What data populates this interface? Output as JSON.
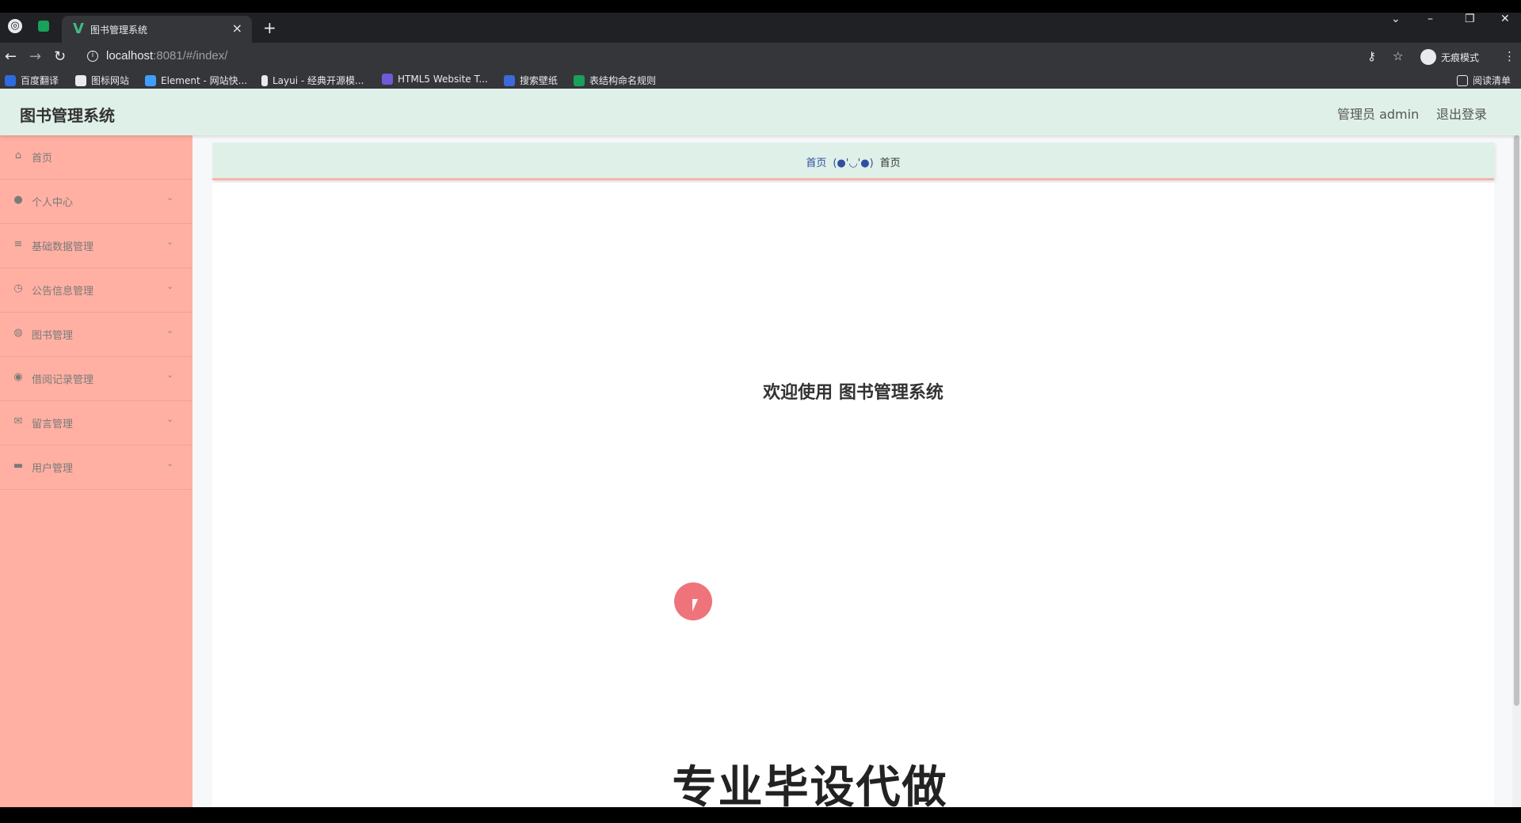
{
  "browser": {
    "tab_title": "图书管理系统",
    "url_host": "localhost",
    "url_rest": ":8081/#/index/",
    "incognito_label": "无痕模式",
    "reading_list": "阅读清单",
    "bookmarks": [
      {
        "label": "百度翻译",
        "color": "#2d6bdf"
      },
      {
        "label": "图标网站",
        "color": "#e8eaed"
      },
      {
        "label": "Element - 网站快...",
        "color": "#409eff"
      },
      {
        "label": "Layui - 经典开源模...",
        "color": "#e8eaed"
      },
      {
        "label": "HTML5 Website T...",
        "color": "#6f5bd8"
      },
      {
        "label": "搜索壁纸",
        "color": "#3b6bd8"
      },
      {
        "label": "表结构命名规则",
        "color": "#19a05a"
      }
    ]
  },
  "app": {
    "title": "图书管理系统",
    "user_label": "管理员 admin",
    "logout_label": "退出登录"
  },
  "sidebar": {
    "items": [
      {
        "label": "首页",
        "icon": "home-icon"
      },
      {
        "label": "个人中心",
        "icon": "user-icon"
      },
      {
        "label": "基础数据管理",
        "icon": "list-icon"
      },
      {
        "label": "公告信息管理",
        "icon": "clock-icon"
      },
      {
        "label": "图书管理",
        "icon": "globe-icon"
      },
      {
        "label": "借阅记录管理",
        "icon": "location-icon"
      },
      {
        "label": "留言管理",
        "icon": "mail-icon"
      },
      {
        "label": "用户管理",
        "icon": "monitor-icon"
      }
    ]
  },
  "breadcrumb": {
    "home": "首页",
    "separator": "(●'◡'●)",
    "current": "首页"
  },
  "main": {
    "welcome": "欢迎使用 图书管理系统"
  },
  "overlay": {
    "watermark": "专业毕设代做"
  },
  "colors": {
    "header_bg": "#dff0e9",
    "sidebar_bg": "#ffb0a2",
    "accent_border": "#f6b5aa"
  }
}
